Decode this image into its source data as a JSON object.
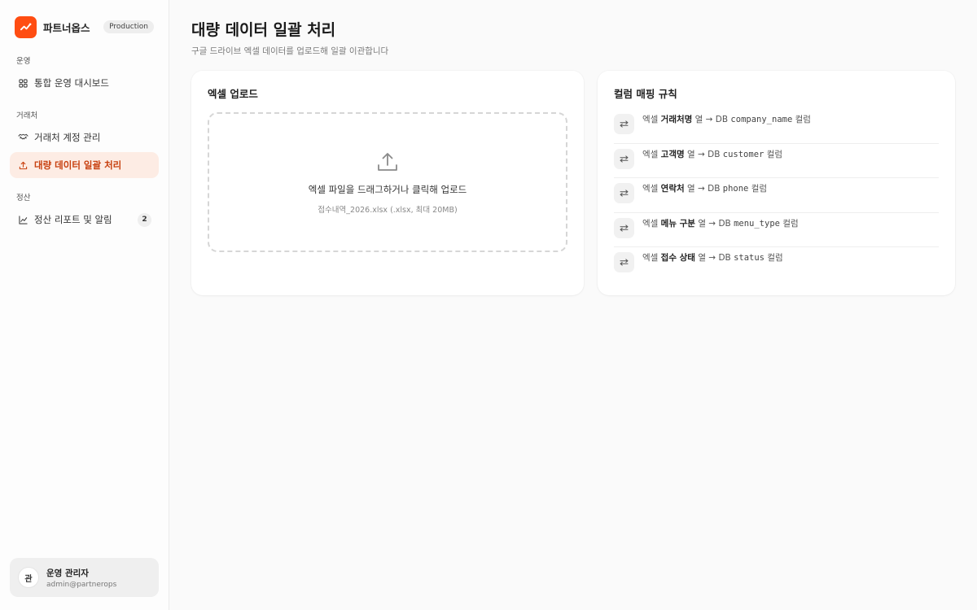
{
  "brand": {
    "name": "파트너옵스",
    "env_badge": "Production",
    "accent": "#ff4d12"
  },
  "sidebar": {
    "sections": [
      {
        "label": "운영",
        "items": [
          {
            "label": "통합 운영 대시보드",
            "icon": "grid-icon",
            "active": false
          }
        ]
      },
      {
        "label": "거래처",
        "items": [
          {
            "label": "거래처 계정 관리",
            "icon": "handshake-icon",
            "active": false
          },
          {
            "label": "대량 데이터 일괄 처리",
            "icon": "upload-icon",
            "active": true
          }
        ]
      },
      {
        "label": "정산",
        "items": [
          {
            "label": "정산 리포트 및 알림",
            "icon": "line-chart-icon",
            "active": false,
            "count": "2"
          }
        ]
      }
    ]
  },
  "user": {
    "avatar_initial": "관",
    "name": "운영 관리자",
    "email": "admin@partnerops"
  },
  "page": {
    "title": "대량 데이터 일괄 처리",
    "subtitle": "구글 드라이브 엑셀 데이터를 업로드해 일괄 이관합니다"
  },
  "upload": {
    "title": "엑셀 업로드",
    "dropzone_text": "엑셀 파일을 드래그하거나 클릭해 업로드",
    "dropzone_hint": "접수내역_2026.xlsx (.xlsx, 최대 20MB)"
  },
  "mapping": {
    "title": "컬럼 매핑 규칙",
    "rules": [
      {
        "prefix": "엑셀",
        "source": "거래처명",
        "middle": "열 → DB",
        "target": "company_name",
        "suffix": "컬럼"
      },
      {
        "prefix": "엑셀",
        "source": "고객명",
        "middle": "열 → DB",
        "target": "customer",
        "suffix": "컬럼"
      },
      {
        "prefix": "엑셀",
        "source": "연락처",
        "middle": "열 → DB",
        "target": "phone",
        "suffix": "컬럼"
      },
      {
        "prefix": "엑셀",
        "source": "메뉴 구분",
        "middle": "열 → DB",
        "target": "menu_type",
        "suffix": "컬럼"
      },
      {
        "prefix": "엑셀",
        "source": "접수 상태",
        "middle": "열 → DB",
        "target": "status",
        "suffix": "컬럼"
      }
    ]
  }
}
